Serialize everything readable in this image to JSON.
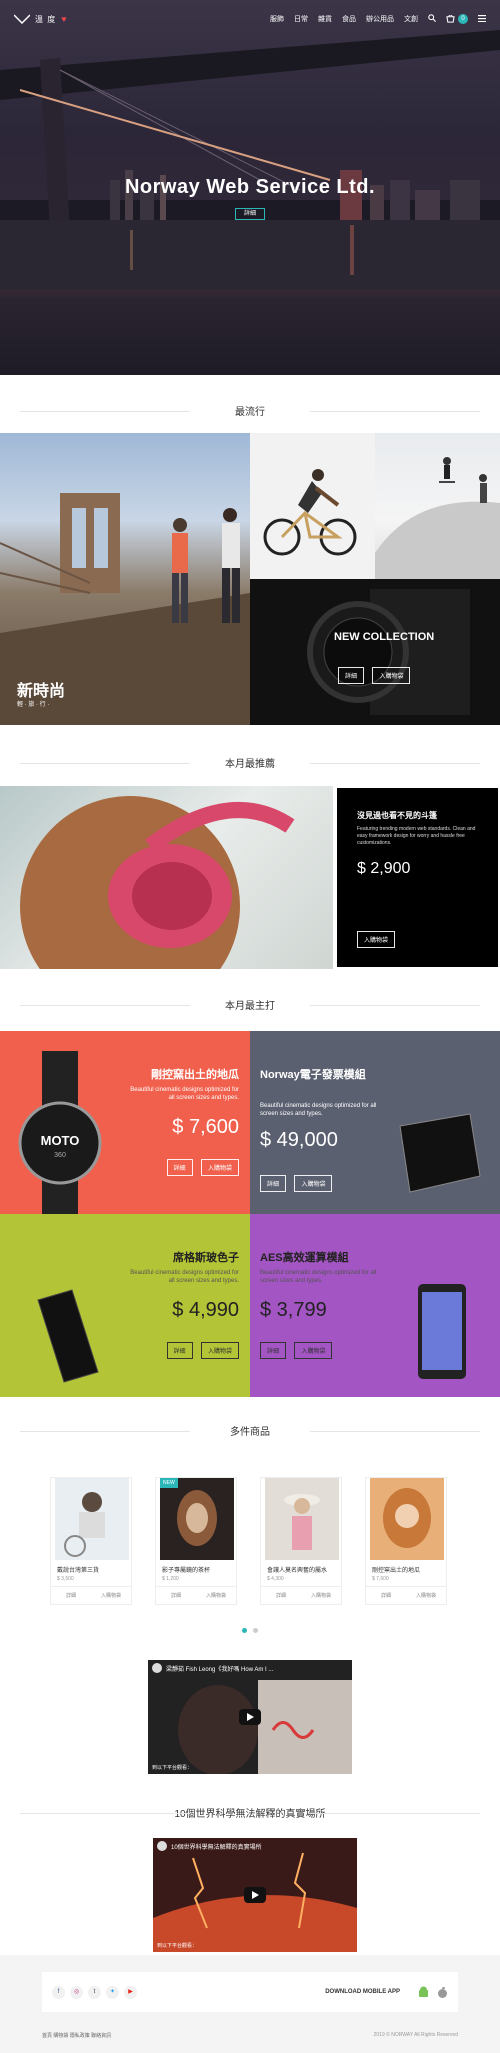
{
  "header": {
    "logo_text": "溫 度",
    "menu": [
      "服飾",
      "日常",
      "雜貨",
      "食品",
      "辦公用品",
      "文創"
    ],
    "cart_count": "0"
  },
  "hero": {
    "title": "Norway Web Service Ltd.",
    "button": "詳細"
  },
  "sections": {
    "popular": "最流行",
    "recommend": "本月最推薦",
    "feature": "本月最主打",
    "many": "多件商品",
    "video2_title": "10個世界科學無法解釋的真實場所"
  },
  "popular": {
    "main_title": "新時尚",
    "main_sub": "輕 · 旅 · 行 ·",
    "collection_title": "NEW COLLECTION",
    "detail": "詳細",
    "buy": "入購物袋"
  },
  "recommend": {
    "title": "沒見過也看不見的斗篷",
    "desc": "Featuring trending modern web standards. Clean and easy framework design for worry and hassle free customizations.",
    "price": "$ 2,900",
    "buy": "入購物袋"
  },
  "feature_tiles": [
    {
      "title": "剛控窯出土的地瓜",
      "desc": "Beautiful cinematic designs optimized for all screen sizes and types.",
      "price": "$ 7,600",
      "detail": "詳細",
      "buy": "入購物袋",
      "color": "#f0604c"
    },
    {
      "title": "Norway電子發票模組",
      "desc": "Beautiful cinematic designs optimized for all screen sizes and types.",
      "price": "$ 49,000",
      "detail": "詳細",
      "buy": "入購物袋",
      "color": "#5b6070"
    },
    {
      "title": "席格斯玻色子",
      "desc": "Beautiful cinematic designs optimized for all screen sizes and types.",
      "price": "$ 4,990",
      "detail": "詳細",
      "buy": "入購物袋",
      "color": "#b3c436"
    },
    {
      "title": "AES高效運算模組",
      "desc": "Beautiful cinematic designs optimized for all screen sizes and types.",
      "price": "$ 3,799",
      "detail": "詳細",
      "buy": "入購物袋",
      "color": "#a355c3"
    }
  ],
  "products": [
    {
      "name": "戴說台灣第三貨",
      "price": "$ 3,500",
      "detail": "詳細",
      "buy": "入購物袋"
    },
    {
      "name": "影子專屬鏡的茶杯",
      "price": "$ 1,200",
      "detail": "詳細",
      "buy": "入購物袋",
      "badge": "NEW"
    },
    {
      "name": "會讓人莫名興奮的屬水",
      "price": "$ 4,300",
      "detail": "詳細",
      "buy": "入購物袋"
    },
    {
      "name": "剛控窯出土的地瓜",
      "price": "$ 7,600",
      "detail": "詳細",
      "buy": "入購物袋"
    }
  ],
  "video1": {
    "title": "梁靜茹 Fish Leong《我好嗎 How Am I ...",
    "bottom": "到以下平台觀看："
  },
  "video2": {
    "title": "10個世界科學無法解釋的真實場所",
    "bottom": "到以下平台觀看："
  },
  "footer": {
    "download": "DOWNLOAD MOBILE APP",
    "links": "首頁  購物袋  隱私政策  聯絡資訊",
    "copyright": "2019 © NORWAY  All Rights Reserved"
  }
}
